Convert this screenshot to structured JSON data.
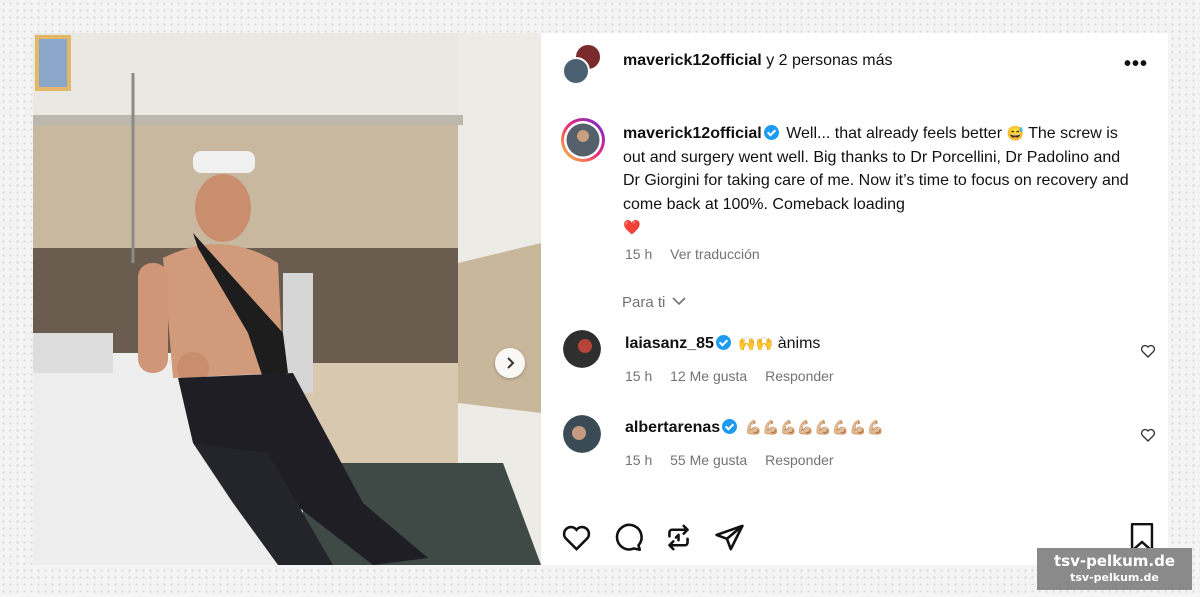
{
  "post": {
    "header": {
      "username": "maverick12official",
      "collab_text": "y 2 personas más",
      "more_icon": "more-options-icon"
    },
    "caption": {
      "username": "maverick12official",
      "text_part1": "Well... that already feels better",
      "emoji1": "😅",
      "text_part2": "The screw is out and surgery went well. Big thanks to Dr Porcellini, Dr Padolino and Dr Giorgini for taking care of me. Now it’s time to focus on recovery and come back at 100%. Comeback loading",
      "emoji2": "❤️",
      "time": "15 h",
      "translate": "Ver traducción"
    },
    "para_ti": "Para ti",
    "comments": [
      {
        "username": "laiasanz_85",
        "emojis": "🙌🙌",
        "text": "ànims",
        "time": "15 h",
        "likes": "12 Me gusta",
        "reply": "Responder"
      },
      {
        "username": "albertarenas",
        "emojis": "💪🏼💪🏼💪🏼💪🏼💪🏼💪🏼💪🏼💪🏼",
        "text": "",
        "time": "15 h",
        "likes": "55 Me gusta",
        "reply": "Responder"
      }
    ],
    "actions": [
      "heart-icon",
      "comment-icon",
      "repost-icon",
      "share-icon",
      "bookmark-icon"
    ],
    "accent_verified": "#1d9bf0"
  },
  "watermark": {
    "line1": "tsv-pelkum.de",
    "line2": "tsv-pelkum.de"
  }
}
